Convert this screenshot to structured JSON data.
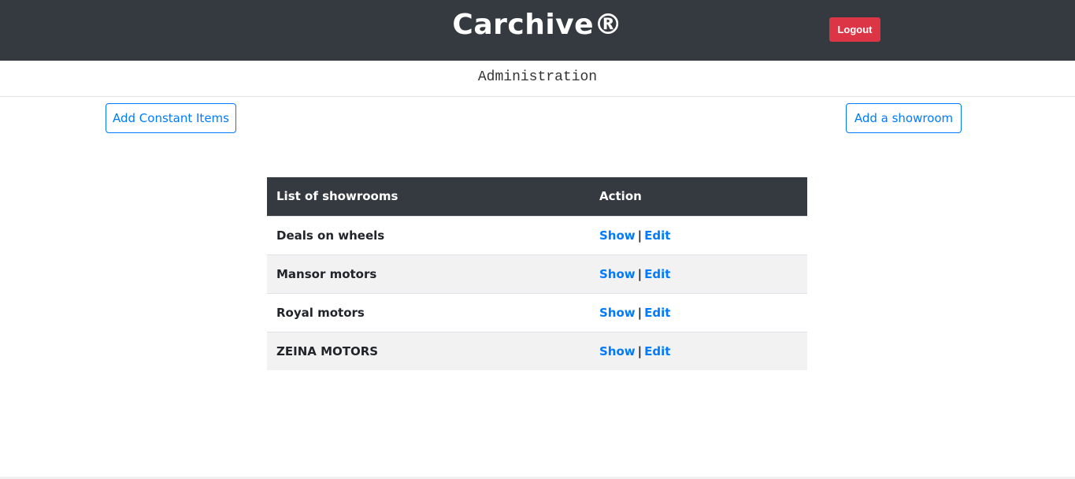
{
  "header": {
    "brand": "Carchive®",
    "logout_label": "Logout"
  },
  "subheader": {
    "title": "Administration"
  },
  "actions": {
    "add_constant_items": "Add Constant Items",
    "add_showroom": "Add a showroom"
  },
  "table": {
    "columns": [
      "List of showrooms",
      "Action"
    ],
    "rows": [
      {
        "name": "Deals on wheels",
        "show": "Show",
        "separator": "|",
        "edit": "Edit"
      },
      {
        "name": "Mansor motors",
        "show": "Show",
        "separator": "|",
        "edit": "Edit"
      },
      {
        "name": "Royal motors",
        "show": "Show",
        "separator": "|",
        "edit": "Edit"
      },
      {
        "name": "ZEINA MOTORS",
        "show": "Show",
        "separator": "|",
        "edit": "Edit"
      }
    ]
  },
  "colors": {
    "header_bg": "#343a40",
    "danger": "#dc3545",
    "primary": "#007bff",
    "stripe": "#f2f2f2"
  }
}
